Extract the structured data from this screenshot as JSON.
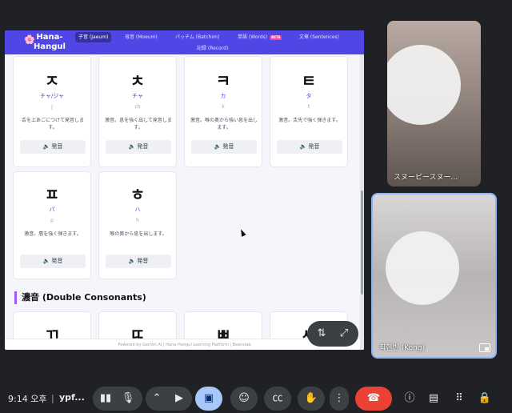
{
  "app": {
    "logo_icon": "🌸",
    "logo_text": "Hana-Hangul",
    "tabs": [
      {
        "label": "子音 (Jaeum)",
        "active": true
      },
      {
        "label": "母音 (Moeum)",
        "active": false
      },
      {
        "label": "パッチム (Batchim)",
        "active": false
      },
      {
        "label": "単語 (Words)",
        "badge": "BETA",
        "active": false
      },
      {
        "label": "文章 (Sentences)",
        "active": false
      },
      {
        "label": "記録 (Record)",
        "active": false
      }
    ],
    "cards": [
      {
        "char": "ㅈ",
        "roman": "チャ/ジャ",
        "ipa": "j",
        "desc": "舌を上あごにつけて発音します。",
        "play": "発音"
      },
      {
        "char": "ㅊ",
        "roman": "チャ",
        "ipa": "ch",
        "desc": "激音。息を強く出して発音します。",
        "play": "発音"
      },
      {
        "char": "ㅋ",
        "roman": "カ",
        "ipa": "k",
        "desc": "激音。喉の奥から強い息を出します。",
        "play": "発音"
      },
      {
        "char": "ㅌ",
        "roman": "タ",
        "ipa": "t",
        "desc": "激音。舌先で強く弾きます。",
        "play": "発音"
      },
      {
        "char": "ㅍ",
        "roman": "パ",
        "ipa": "p",
        "desc": "激音。唇を強く弾きます。",
        "play": "発音"
      },
      {
        "char": "ㅎ",
        "roman": "ハ",
        "ipa": "h",
        "desc": "喉の奥から息を出します。",
        "play": "発音"
      }
    ],
    "double_chars": [
      "ㄲ",
      "ㄸ",
      "ㅃ",
      "ㅆ"
    ],
    "section_title": "濃音 (Double Consonants)",
    "footer": "Powered by Gemini AI | Hana-Hangul Learning Platform | Beanslab"
  },
  "participants": [
    {
      "name": "スヌーピースヌー..."
    },
    {
      "name": "최현빈 (Kong)"
    }
  ],
  "toolbar": {
    "time": "9:14 오후",
    "divider": "|",
    "meeting_code": "ypf..."
  },
  "icons": [
    "speaker-icon",
    "mic-icon",
    "chevron-up-icon",
    "camera-icon",
    "present-icon",
    "emoji-icon",
    "captions-icon",
    "raise-hand-icon",
    "more-icon",
    "hangup-icon",
    "info-icon",
    "chat-icon",
    "activities-icon",
    "host-controls-icon",
    "swap-icon",
    "expand-icon",
    "pip-icon"
  ],
  "colors": {
    "brand": "#4f46e5",
    "hangup": "#ea4335",
    "present": "#a8c7fa",
    "section_accent": "#a855f7"
  }
}
